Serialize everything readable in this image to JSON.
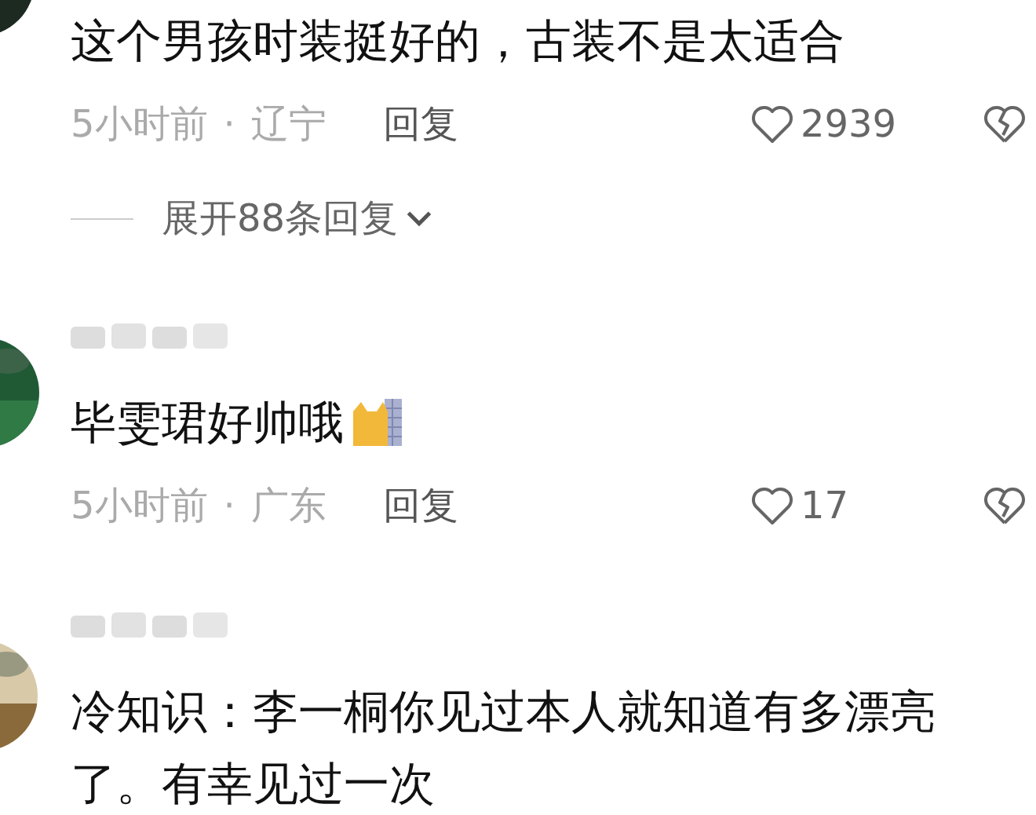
{
  "comments": [
    {
      "name_blurred": false,
      "text": "这个男孩时装挺好的，古装不是太适合",
      "sticker": false,
      "time": "5小时前",
      "separator": "·",
      "location": "辽宁",
      "reply": "回复",
      "likes": "2939",
      "expand": "展开88条回复"
    },
    {
      "name_blurred": true,
      "text": "毕雯珺好帅哦",
      "sticker": true,
      "time": "5小时前",
      "separator": "·",
      "location": "广东",
      "reply": "回复",
      "likes": "17"
    },
    {
      "name_blurred": true,
      "text": "冷知识：李一桐你见过本人就知道有多漂亮了。有幸见过一次",
      "sticker": false
    }
  ]
}
